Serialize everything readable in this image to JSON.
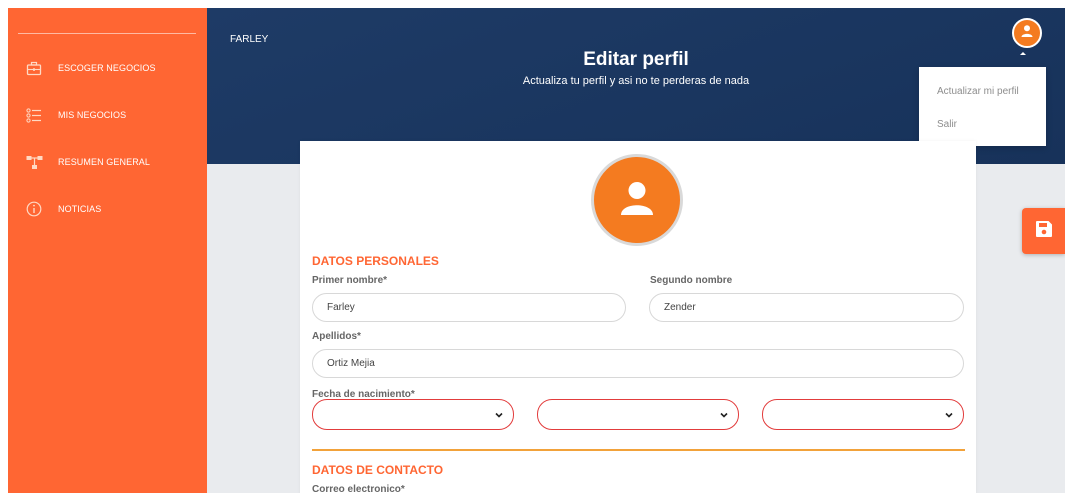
{
  "sidebar": {
    "items": [
      {
        "label": "ESCOGER NEGOCIOS",
        "icon": "briefcase-icon"
      },
      {
        "label": "MIS NEGOCIOS",
        "icon": "list-icon"
      },
      {
        "label": "RESUMEN GENERAL",
        "icon": "hierarchy-icon"
      },
      {
        "label": "NOTICIAS",
        "icon": "info-icon"
      }
    ]
  },
  "header": {
    "username": "FARLEY",
    "title": "Editar perfil",
    "subtitle": "Actualiza tu perfil y asi no te perderas de nada"
  },
  "user_menu": {
    "items": [
      "Actualizar mi perfil",
      "Salir"
    ]
  },
  "form": {
    "personal_section": "DATOS PERSONALES",
    "first_name": {
      "label": "Primer nombre*",
      "value": "Farley"
    },
    "second_name": {
      "label": "Segundo nombre",
      "value": "Zender"
    },
    "last_names": {
      "label": "Apellidos*",
      "value": "Ortiz Mejia"
    },
    "birth_date": {
      "label": "Fecha de nacimiento*",
      "day": "",
      "month": "",
      "year": ""
    },
    "contact_section": "DATOS DE CONTACTO",
    "email_label": "Correo electronico*"
  },
  "colors": {
    "sidebar": "#ff6633",
    "header": "#1e3b66",
    "accent": "#f47b20",
    "invalid_border": "#e23c3c"
  }
}
